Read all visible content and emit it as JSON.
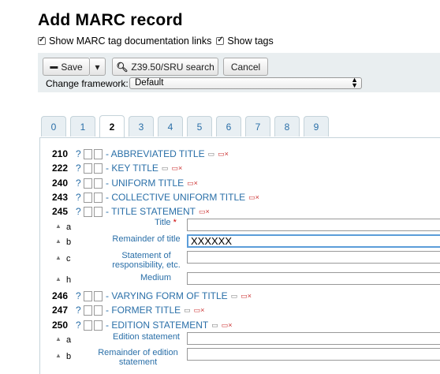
{
  "page_title": "Add MARC record",
  "options": {
    "doc_links_label": "Show MARC tag documentation links",
    "show_tags_label": "Show tags"
  },
  "toolbar": {
    "save_label": "Save",
    "dropdown_caret": "▾",
    "z3950_label": "Z39.50/SRU search",
    "cancel_label": "Cancel",
    "framework_label": "Change framework:",
    "framework_value": "Default"
  },
  "tabs": [
    "0",
    "1",
    "2",
    "3",
    "4",
    "5",
    "6",
    "7",
    "8",
    "9"
  ],
  "active_tab": "2",
  "tags": [
    {
      "num": "210",
      "q": "?",
      "name": "- ABBREVIATED TITLE"
    },
    {
      "num": "222",
      "q": "?",
      "name": "- KEY TITLE"
    },
    {
      "num": "240",
      "q": "?",
      "name": "- UNIFORM TITLE"
    },
    {
      "num": "243",
      "q": "?",
      "name": "- COLLECTIVE UNIFORM TITLE"
    },
    {
      "num": "245",
      "q": "?",
      "name": "- TITLE STATEMENT"
    },
    {
      "num": "246",
      "q": "?",
      "name": "- VARYING FORM OF TITLE"
    },
    {
      "num": "247",
      "q": "?",
      "name": "- FORMER TITLE"
    },
    {
      "num": "250",
      "q": "?",
      "name": "- EDITION STATEMENT"
    }
  ],
  "subfields_245": [
    {
      "code": "a",
      "label": "Title",
      "required": "*",
      "value": ""
    },
    {
      "code": "b",
      "label": "Remainder of title",
      "value": "XXXXXX"
    },
    {
      "code": "c",
      "label": "Statement of responsibility, etc.",
      "value": ""
    },
    {
      "code": "h",
      "label": "Medium",
      "value": ""
    }
  ],
  "subfields_250": [
    {
      "code": "a",
      "label": "Edition statement",
      "value": ""
    },
    {
      "code": "b",
      "label": "Remainder of edition statement",
      "value": ""
    }
  ]
}
